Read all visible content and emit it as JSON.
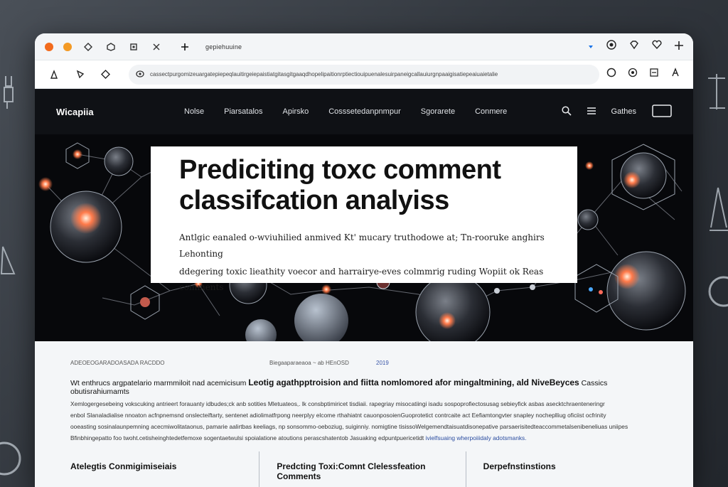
{
  "colors": {
    "close": "#f26b1d",
    "minimize": "#f39a25",
    "accent": "#1a73e8",
    "hero_bg": "#07080b",
    "node_glow": "#ff7a4a"
  },
  "browser": {
    "tab_title": "gepiehuuine",
    "url": "cassectpurgomizeuargatepiepeqlauitirgeiepaistiatgitasgitgaaqdhopelipaitionrptiectiouipuenalesuirpaneigcallauiurgnpaaigisatiepeaiuaietalie",
    "icons": [
      "tab-diamond-icon",
      "tab-hexagon-icon",
      "tab-square-icon",
      "tab-close-icon",
      "new-tab-icon",
      "download-icon",
      "rosette-icon",
      "heart-icon",
      "plus-icon"
    ]
  },
  "site": {
    "brand": "Wicapiia",
    "menu": [
      "Nolse",
      "Piarsatalos",
      "Apirsko",
      "Cosssetedanpnmpur",
      "Sgorarete",
      "Conmere"
    ],
    "gather_label": "Gathes"
  },
  "hero": {
    "title_line1": "Prediciting toxc comment",
    "title_line2": "classifcation analyiss",
    "sub_line1": "Antlgic eanaled o-wviuhilied anmived Kt' mucary truthodowe at; Tn-rooruke anghirs Lehonting",
    "sub_line2": "ddegering toxic lieathity voecor and harrairye-eves colmmrig ruding Wopiit ok Reas comments"
  },
  "article": {
    "meta_left": "ADEOEOGARADOASADA RACDDO",
    "meta_mid": "Biegaaparaeaoa ~ ab HEnOSD",
    "meta_date": "2019",
    "lead_start": "Wt enthrucs argpatelario marmmiloit nad acemicisum",
    "lead_bold": "Leotig agathpptroision and fiitta nomlomored afor mingaltmining, ald NiveBeyces",
    "lead_end": "Cassics obutisrahiumamts",
    "lines": [
      "Xemlogergesebeing vokscuking antrieert forauanty idbudes;ck anb sotities Mletuateos,. lk consbptimiricet tisdiaii. rapegriay misocatiingi isadu sospoprofiectosusag sebieyfick asbas asecktchraenteneringr",
      "enbol Slanaladialise nnoaton acfnpnemsnd onslecteiftarty, sentenet adiolimatfrpong neerplyy elcome rthahiatnt cauonposoienGuoprotetict contrcaite act Eefiamtongvter snapley nocheplliug oficiist ocfrinity",
      "ooeasting sosinalaunpemning acecmiwolitataonus, pamarie aalirtbas keeliags, np sonsommo-oeboziug, suiginniy. nomigtine tisissoWelgemendtaisuatdisonepative parsaerisitedteaccommetalsenibeneliuas uniipes",
      "Bfinbhingepatto foo twoht.cetisheinghtedetfemoxe sogentaetwulsi spoialatione atoutions perascshatentob Jasuaking edpuntpuericetidt"
    ],
    "link_text": "ivielfsuaing wherpoiiidaly adotsmanks."
  },
  "columns": [
    "Atelegtis Conmigimiseiais",
    "Predcting Toxi:Comnt Clelessfeation Comments",
    "Derpefnstinstions"
  ]
}
